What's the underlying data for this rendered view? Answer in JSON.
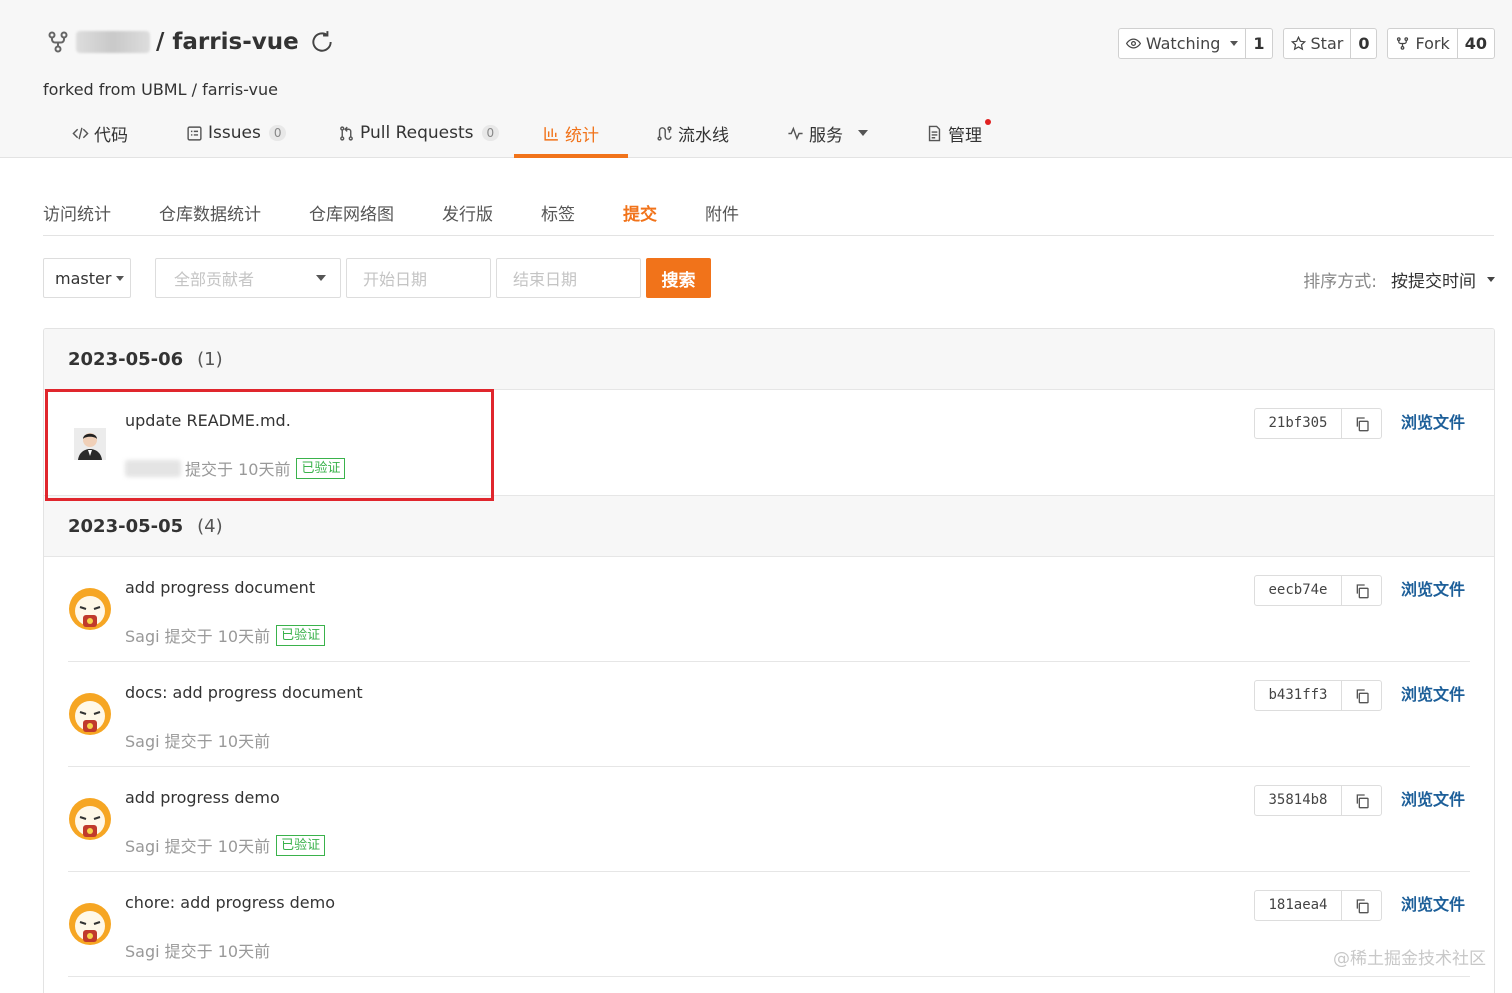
{
  "repo": {
    "title": "/ farris-vue",
    "forked_from": "forked from UBML / farris-vue"
  },
  "actions": {
    "watch": {
      "label": "Watching",
      "count": "1"
    },
    "star": {
      "label": "Star",
      "count": "0"
    },
    "fork": {
      "label": "Fork",
      "count": "40"
    }
  },
  "tabs": [
    {
      "label": "代码",
      "icon": "code-icon"
    },
    {
      "label": "Issues",
      "badge": "0",
      "icon": "issues-icon"
    },
    {
      "label": "Pull Requests",
      "badge": "0",
      "icon": "pull-request-icon"
    },
    {
      "label": "统计",
      "icon": "chart-icon",
      "active": true
    },
    {
      "label": "流水线",
      "icon": "pipeline-icon"
    },
    {
      "label": "服务",
      "icon": "pulse-icon"
    },
    {
      "label": "管理",
      "icon": "manage-icon"
    }
  ],
  "subtabs": [
    "访问统计",
    "仓库数据统计",
    "仓库网络图",
    "发行版",
    "标签",
    "提交",
    "附件"
  ],
  "filters": {
    "branch": "master",
    "contributors_placeholder": "全部贡献者",
    "start_placeholder": "开始日期",
    "end_placeholder": "结束日期",
    "search_label": "搜索",
    "sort_label": "排序方式:",
    "sort_value": "按提交时间"
  },
  "groups": [
    {
      "date": "2023-05-06",
      "count": "(1)"
    },
    {
      "date": "2023-05-05",
      "count": "(4)"
    }
  ],
  "commits": [
    {
      "message": "update README.md.",
      "meta": "提交于 10天前",
      "verified": "已验证",
      "sha": "21bf305",
      "browse": "浏览文件"
    },
    {
      "message": "add progress document",
      "meta": "Sagi 提交于 10天前",
      "verified": "已验证",
      "sha": "eecb74e",
      "browse": "浏览文件"
    },
    {
      "message": "docs: add progress document",
      "meta": "Sagi 提交于 10天前",
      "sha": "b431ff3",
      "browse": "浏览文件"
    },
    {
      "message": "add progress demo",
      "meta": "Sagi 提交于 10天前",
      "verified": "已验证",
      "sha": "35814b8",
      "browse": "浏览文件"
    },
    {
      "message": "chore: add progress demo",
      "meta": "Sagi 提交于 10天前",
      "sha": "181aea4",
      "browse": "浏览文件"
    }
  ],
  "watermark": "@稀土掘金技术社区",
  "colors": {
    "accent": "#f1731a",
    "link": "#1d5f99",
    "verified": "#3ab24b",
    "highlight": "#e0262d"
  }
}
